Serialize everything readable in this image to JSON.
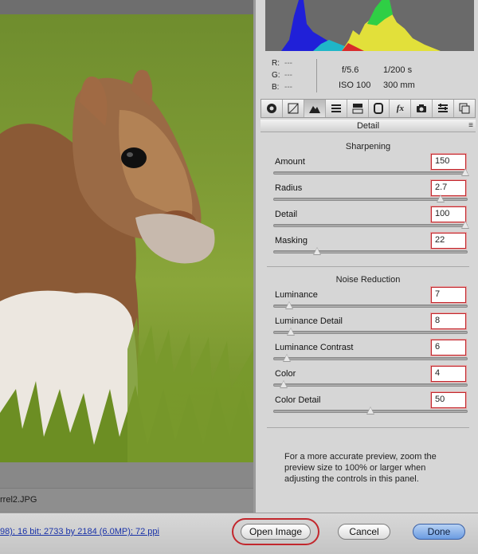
{
  "preview": {
    "filename": "rrel2.JPG"
  },
  "histogram": {
    "r_label": "R:",
    "g_label": "G:",
    "b_label": "B:",
    "r_value": "---",
    "g_value": "---",
    "b_value": "---",
    "aperture": "f/5.6",
    "shutter": "1/200 s",
    "iso": "ISO 100",
    "focal_length": "300 mm"
  },
  "tabs": [
    {
      "icon": "basic-icon"
    },
    {
      "icon": "tone-curve-icon"
    },
    {
      "icon": "detail-icon"
    },
    {
      "icon": "hsl-icon"
    },
    {
      "icon": "split-toning-icon"
    },
    {
      "icon": "lens-corrections-icon"
    },
    {
      "icon": "effects-icon",
      "label": "fx"
    },
    {
      "icon": "camera-calibration-icon"
    },
    {
      "icon": "presets-icon"
    },
    {
      "icon": "snapshots-icon"
    }
  ],
  "panel": {
    "title": "Detail"
  },
  "sharpening": {
    "title": "Sharpening",
    "controls": [
      {
        "label": "Amount",
        "value": "150",
        "level": 1.0
      },
      {
        "label": "Radius",
        "value": "2.7",
        "level": 0.87
      },
      {
        "label": "Detail",
        "value": "100",
        "level": 1.0
      },
      {
        "label": "Masking",
        "value": "22",
        "level": 0.22
      }
    ]
  },
  "noise": {
    "title": "Noise Reduction",
    "controls": [
      {
        "label": "Luminance",
        "value": "7",
        "level": 0.07
      },
      {
        "label": "Luminance Detail",
        "value": "8",
        "level": 0.08
      },
      {
        "label": "Luminance Contrast",
        "value": "6",
        "level": 0.06
      },
      {
        "label": "Color",
        "value": "4",
        "level": 0.04
      },
      {
        "label": "Color Detail",
        "value": "50",
        "level": 0.5
      }
    ]
  },
  "info": {
    "text": "For a more accurate preview, zoom the preview size to 100% or larger when adjusting the controls in this panel."
  },
  "bottom": {
    "workflow": "98); 16 bit; 2733 by 2184 (6.0MP); 72 ppi",
    "open_label": "Open Image",
    "cancel_label": "Cancel",
    "done_label": "Done"
  }
}
